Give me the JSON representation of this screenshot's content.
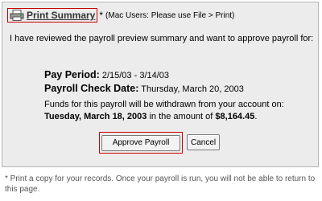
{
  "print": {
    "icon": "printer-icon",
    "link_label": "Print Summary",
    "asterisk": "*",
    "mac_note": "(Mac Users: Please use File > Print)"
  },
  "intro": "I have reviewed the payroll preview summary and want to approve payroll for:",
  "pay_period": {
    "label": "Pay Period:",
    "value": "2/15/03 - 3/14/03"
  },
  "check_date": {
    "label": "Payroll Check Date:",
    "value": "Thursday, March 20, 2003"
  },
  "funds": {
    "text_before": "Funds for this payroll will be withdrawn from your account on:",
    "date": "Tuesday, March 18, 2003",
    "text_middle": "in the amount of",
    "amount": "$8,164.45",
    "text_end": "."
  },
  "buttons": {
    "approve": "Approve Payroll",
    "cancel": "Cancel"
  },
  "footnote": "* Print a copy for your records. Once your payroll is run, you will not be able to return to this page.",
  "colors": {
    "highlight_border": "#cc0000",
    "panel_bg": "#ececec"
  }
}
